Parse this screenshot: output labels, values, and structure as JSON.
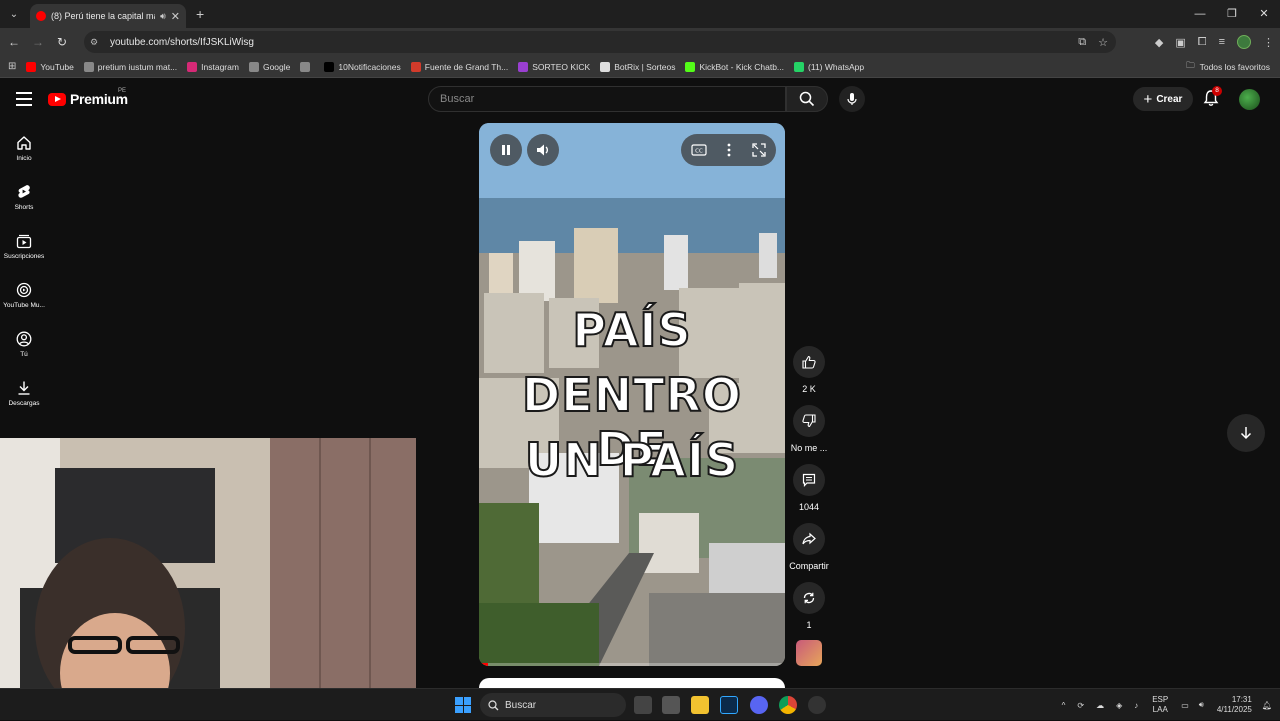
{
  "browser": {
    "tab_title": "(8) Perú tiene la capital má",
    "url": "youtube.com/shorts/IfJSKLiWisg",
    "new_tab": "+",
    "bookmarks": [
      {
        "label": "YouTube",
        "color": "#ff0000"
      },
      {
        "label": "pretium iustum mat...",
        "color": "#888888"
      },
      {
        "label": "Instagram",
        "color": "#d62976"
      },
      {
        "label": "Google",
        "color": "#888888"
      },
      {
        "label": "",
        "color": "#888888"
      },
      {
        "label": "10Notificaciones",
        "color": "#000000"
      },
      {
        "label": "Fuente de Grand Th...",
        "color": "#d23b2b"
      },
      {
        "label": "SORTEO KICK",
        "color": "#9a3fd1"
      },
      {
        "label": "BotRix | Sorteos",
        "color": "#dddddd"
      },
      {
        "label": "KickBot - Kick Chatb...",
        "color": "#53fc18"
      },
      {
        "label": "(11) WhatsApp",
        "color": "#25d366"
      }
    ],
    "all_bookmarks": "Todos los favoritos"
  },
  "youtube": {
    "logo_text": "Premium",
    "country_code": "PE",
    "search_placeholder": "Buscar",
    "create_label": "Crear",
    "notifications_count": "8",
    "sidebar": [
      {
        "label": "Inicio",
        "icon": "home-icon"
      },
      {
        "label": "Shorts",
        "icon": "shorts-icon"
      },
      {
        "label": "Suscripciones",
        "icon": "subscriptions-icon"
      },
      {
        "label": "YouTube Mu...",
        "icon": "youtube-music-icon"
      },
      {
        "label": "Tú",
        "icon": "you-icon"
      },
      {
        "label": "Descargas",
        "icon": "downloads-icon"
      }
    ],
    "short": {
      "overlay_lines": [
        "PAÍS",
        "DENTRO DE",
        "UN PAÍS"
      ],
      "progress": 0.03
    },
    "actions": {
      "likes": "2 K",
      "dislike": "No me ...",
      "comments": "1044",
      "share": "Compartir",
      "remix": "1"
    }
  },
  "taskbar": {
    "search": "Buscar",
    "lang_line1": "ESP",
    "lang_line2": "LAA",
    "time": "17:31",
    "date": "4/11/2025"
  }
}
